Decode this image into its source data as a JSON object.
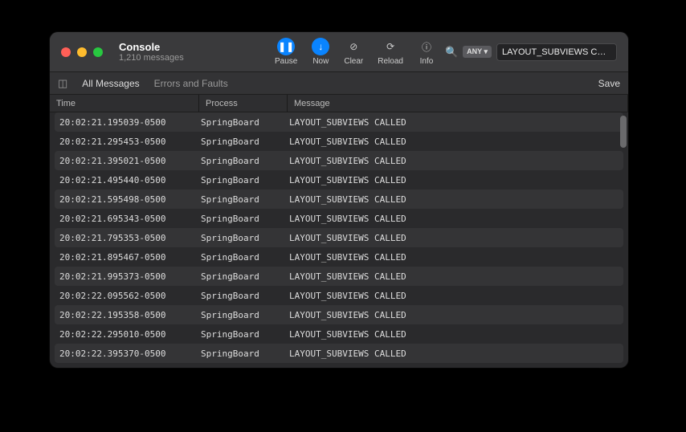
{
  "window": {
    "title": "Console",
    "subtitle": "1,210 messages"
  },
  "toolbar": {
    "pause": "Pause",
    "now": "Now",
    "clear": "Clear",
    "reload": "Reload",
    "info": "Info"
  },
  "search": {
    "badge": "ANY ▾",
    "value": "LAYOUT_SUBVIEWS C…"
  },
  "subbar": {
    "all": "All Messages",
    "errors": "Errors and Faults",
    "save": "Save"
  },
  "columns": {
    "time": "Time",
    "process": "Process",
    "message": "Message"
  },
  "rows": [
    {
      "time": "20:02:21.195039-0500",
      "process": "SpringBoard",
      "message": "LAYOUT_SUBVIEWS CALLED"
    },
    {
      "time": "20:02:21.295453-0500",
      "process": "SpringBoard",
      "message": "LAYOUT_SUBVIEWS CALLED"
    },
    {
      "time": "20:02:21.395021-0500",
      "process": "SpringBoard",
      "message": "LAYOUT_SUBVIEWS CALLED"
    },
    {
      "time": "20:02:21.495440-0500",
      "process": "SpringBoard",
      "message": "LAYOUT_SUBVIEWS CALLED"
    },
    {
      "time": "20:02:21.595498-0500",
      "process": "SpringBoard",
      "message": "LAYOUT_SUBVIEWS CALLED"
    },
    {
      "time": "20:02:21.695343-0500",
      "process": "SpringBoard",
      "message": "LAYOUT_SUBVIEWS CALLED"
    },
    {
      "time": "20:02:21.795353-0500",
      "process": "SpringBoard",
      "message": "LAYOUT_SUBVIEWS CALLED"
    },
    {
      "time": "20:02:21.895467-0500",
      "process": "SpringBoard",
      "message": "LAYOUT_SUBVIEWS CALLED"
    },
    {
      "time": "20:02:21.995373-0500",
      "process": "SpringBoard",
      "message": "LAYOUT_SUBVIEWS CALLED"
    },
    {
      "time": "20:02:22.095562-0500",
      "process": "SpringBoard",
      "message": "LAYOUT_SUBVIEWS CALLED"
    },
    {
      "time": "20:02:22.195358-0500",
      "process": "SpringBoard",
      "message": "LAYOUT_SUBVIEWS CALLED"
    },
    {
      "time": "20:02:22.295010-0500",
      "process": "SpringBoard",
      "message": "LAYOUT_SUBVIEWS CALLED"
    },
    {
      "time": "20:02:22.395370-0500",
      "process": "SpringBoard",
      "message": "LAYOUT_SUBVIEWS CALLED"
    }
  ]
}
